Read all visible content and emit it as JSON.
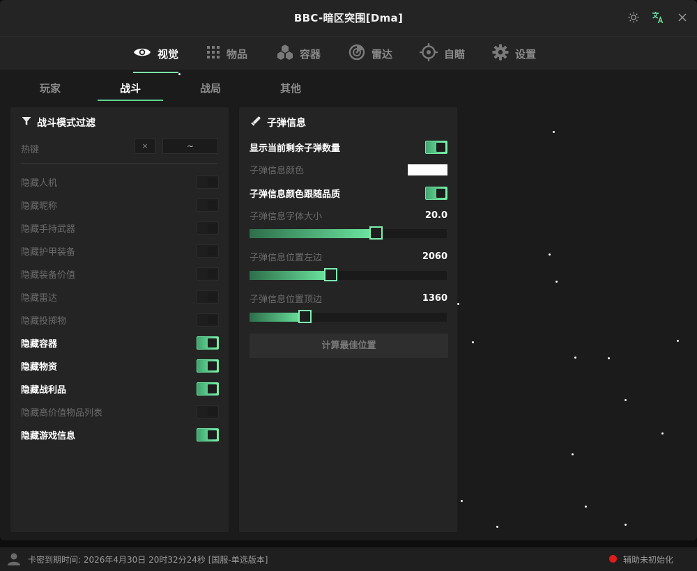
{
  "window": {
    "title": "BBC-暗区突围[Dma]"
  },
  "titlebar": {
    "theme_icon": "sun-icon",
    "language_icon": "translate-icon",
    "close_icon": "close-icon"
  },
  "main_nav": {
    "tabs": [
      {
        "label": "视觉",
        "icon": "eye-icon",
        "active": true
      },
      {
        "label": "物品",
        "icon": "grid-icon",
        "active": false
      },
      {
        "label": "容器",
        "icon": "cubes-icon",
        "active": false
      },
      {
        "label": "雷达",
        "icon": "radar-icon",
        "active": false
      },
      {
        "label": "自瞄",
        "icon": "crosshair-icon",
        "active": false
      },
      {
        "label": "设置",
        "icon": "gear-icon",
        "active": false
      }
    ]
  },
  "sub_nav": {
    "tabs": [
      {
        "label": "玩家",
        "active": false
      },
      {
        "label": "战斗",
        "active": true
      },
      {
        "label": "战局",
        "active": false
      },
      {
        "label": "其他",
        "active": false
      }
    ]
  },
  "filter_panel": {
    "title": "战斗模式过滤",
    "icon": "filter-icon",
    "hotkey": {
      "label": "热键",
      "clear": "×",
      "key": "~"
    },
    "items": [
      {
        "label": "隐藏人机",
        "on": false
      },
      {
        "label": "隐藏昵称",
        "on": false
      },
      {
        "label": "隐藏手持武器",
        "on": false
      },
      {
        "label": "隐藏护甲装备",
        "on": false
      },
      {
        "label": "隐藏装备价值",
        "on": false
      },
      {
        "label": "隐藏雷达",
        "on": false
      },
      {
        "label": "隐藏投掷物",
        "on": false
      },
      {
        "label": "隐藏容器",
        "on": true
      },
      {
        "label": "隐藏物资",
        "on": true
      },
      {
        "label": "隐藏战利品",
        "on": true
      },
      {
        "label": "隐藏高价值物品列表",
        "on": false
      },
      {
        "label": "隐藏游戏信息",
        "on": true
      }
    ]
  },
  "bullet_panel": {
    "title": "子弹信息",
    "icon": "bullet-icon",
    "show_count": {
      "label": "显示当前剩余子弹数量",
      "on": true
    },
    "color": {
      "label": "子弹信息颜色",
      "value": "#ffffff"
    },
    "follow_quality": {
      "label": "子弹信息颜色跟随品质",
      "on": true
    },
    "font_size": {
      "label": "子弹信息字体大小",
      "value": "20.0",
      "fill": 0.64
    },
    "pos_left": {
      "label": "子弹信息位置左边",
      "value": "2060",
      "fill": 0.41
    },
    "pos_top": {
      "label": "子弹信息位置顶边",
      "value": "1360",
      "fill": 0.28
    },
    "calc_button": "计算最佳位置"
  },
  "footer": {
    "expiry": "卡密到期时间: 2026年4月30日  20时32分24秒 [国服-单选版本]",
    "status": "辅助未初始化",
    "status_color": "#e21b1b"
  }
}
